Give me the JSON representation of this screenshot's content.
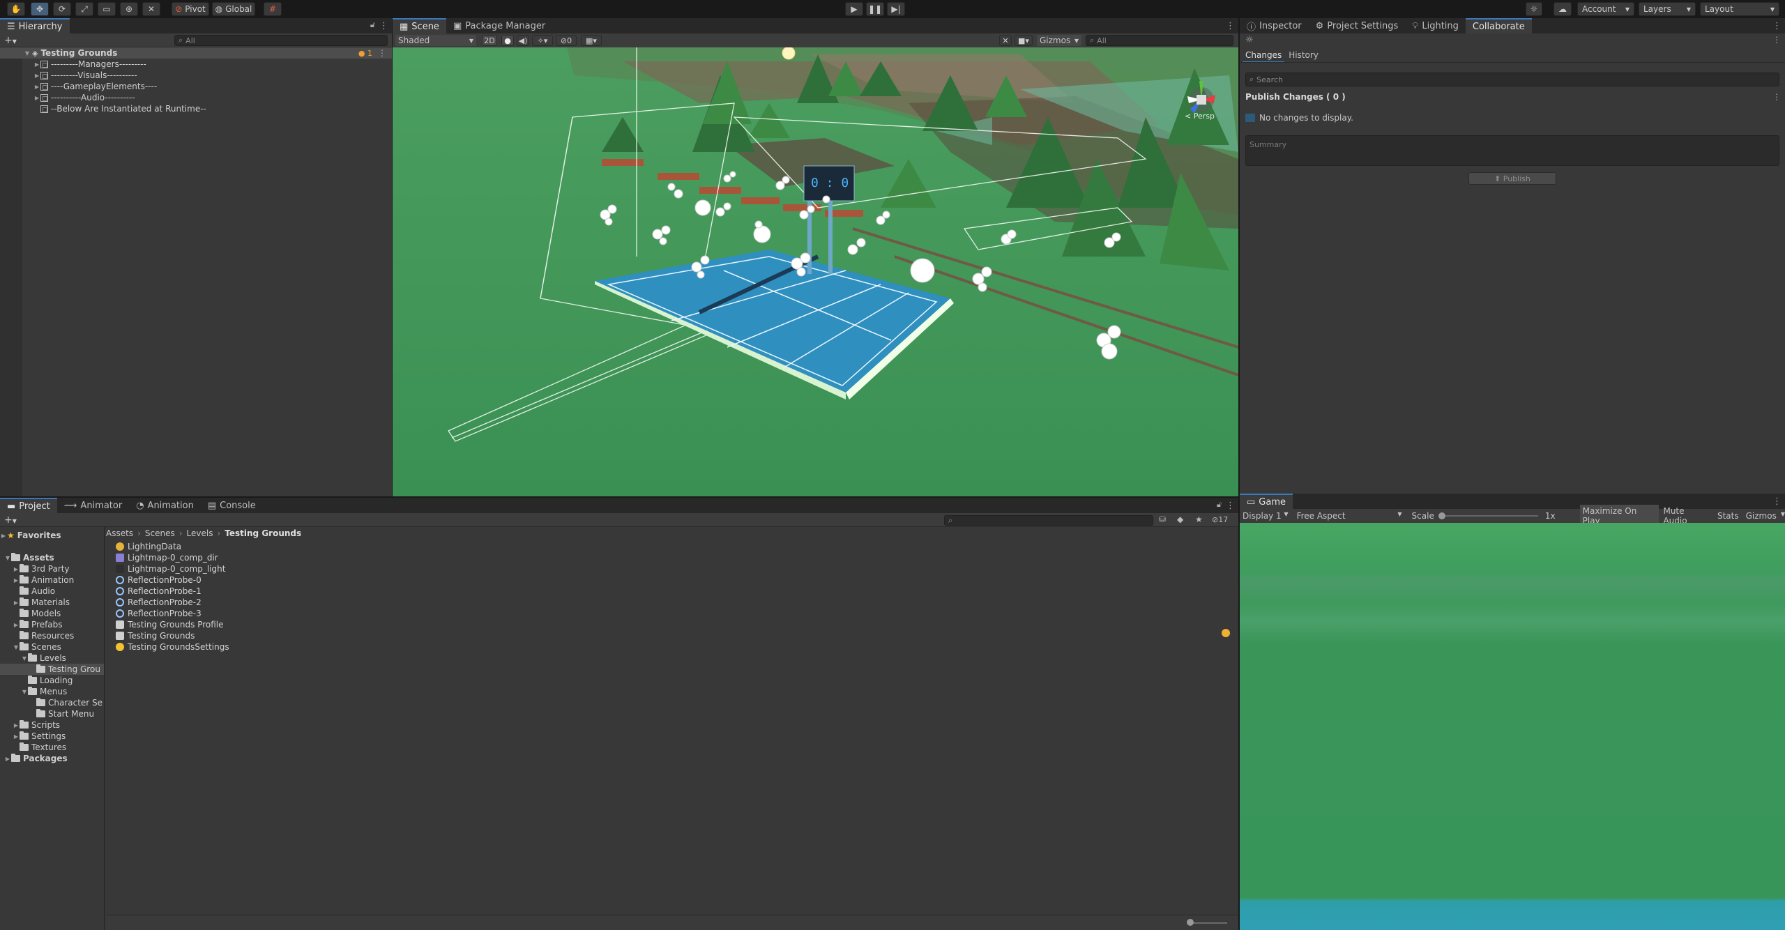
{
  "toolbar": {
    "tools": [
      "hand-tool",
      "move-tool",
      "rotate-tool",
      "scale-tool",
      "rect-tool",
      "transform-tool",
      "custom-tool"
    ],
    "pivot_label": "Pivot",
    "global_label": "Global",
    "account_label": "Account",
    "layers_label": "Layers",
    "layout_label": "Layout"
  },
  "hierarchy": {
    "tab_label": "Hierarchy",
    "search_placeholder": "All",
    "scene_name": "Testing Grounds",
    "badge_count": "1",
    "items": [
      "---------Managers---------",
      "---------Visuals----------",
      "----GameplayElements----",
      "----------Audio----------",
      "--Below Are Instantiated at Runtime--"
    ]
  },
  "scene_view": {
    "tabs": [
      "Scene",
      "Package Manager"
    ],
    "shading_mode": "Shaded",
    "mode_2d": "2D",
    "hidden_count": "0",
    "gizmos_label": "Gizmos",
    "search_placeholder": "All",
    "persp_label": "< Persp",
    "axis_labels": {
      "x": "x",
      "y": "y",
      "z": "z"
    }
  },
  "inspector": {
    "tabs": [
      "Inspector",
      "Project Settings",
      "Lighting",
      "Collaborate"
    ],
    "sub_tabs": [
      "Changes",
      "History"
    ],
    "search_placeholder": "Search",
    "publish_changes_title": "Publish Changes ( 0 )",
    "no_changes_text": "No changes to display.",
    "summary_placeholder": "Summary",
    "publish_button": "Publish"
  },
  "project": {
    "tabs": [
      "Project",
      "Animator",
      "Animation",
      "Console"
    ],
    "hidden_count": "17",
    "favorites_label": "Favorites",
    "folder_tree": [
      {
        "label": "Assets",
        "depth": 0,
        "open": true,
        "bold": true
      },
      {
        "label": "3rd Party",
        "depth": 1,
        "open": false
      },
      {
        "label": "Animation",
        "depth": 1,
        "open": false
      },
      {
        "label": "Audio",
        "depth": 1,
        "open": null
      },
      {
        "label": "Materials",
        "depth": 1,
        "open": false
      },
      {
        "label": "Models",
        "depth": 1,
        "open": null
      },
      {
        "label": "Prefabs",
        "depth": 1,
        "open": false
      },
      {
        "label": "Resources",
        "depth": 1,
        "open": null
      },
      {
        "label": "Scenes",
        "depth": 1,
        "open": true
      },
      {
        "label": "Levels",
        "depth": 2,
        "open": true
      },
      {
        "label": "Testing Grou",
        "depth": 3,
        "open": null,
        "selected": true
      },
      {
        "label": "Loading",
        "depth": 2,
        "open": null
      },
      {
        "label": "Menus",
        "depth": 2,
        "open": true
      },
      {
        "label": "Character Se",
        "depth": 3,
        "open": null
      },
      {
        "label": "Start Menu",
        "depth": 3,
        "open": null
      },
      {
        "label": "Scripts",
        "depth": 1,
        "open": false
      },
      {
        "label": "Settings",
        "depth": 1,
        "open": false
      },
      {
        "label": "Textures",
        "depth": 1,
        "open": null
      },
      {
        "label": "Packages",
        "depth": 0,
        "open": false,
        "bold": true
      }
    ],
    "breadcrumb": [
      "Assets",
      "Scenes",
      "Levels",
      "Testing Grounds"
    ],
    "assets": [
      {
        "label": "LightingData",
        "icon": "lighting-data-icon",
        "color": "#e8b23a"
      },
      {
        "label": "Lightmap-0_comp_dir",
        "icon": "texture-icon",
        "color": "#8a7fd6"
      },
      {
        "label": "Lightmap-0_comp_light",
        "icon": "texture-icon",
        "color": "#2f2f2f"
      },
      {
        "label": "ReflectionProbe-0",
        "icon": "reflection-probe-icon",
        "color": "#9ac6ff"
      },
      {
        "label": "ReflectionProbe-1",
        "icon": "reflection-probe-icon",
        "color": "#9ac6ff"
      },
      {
        "label": "ReflectionProbe-2",
        "icon": "reflection-probe-icon",
        "color": "#9ac6ff"
      },
      {
        "label": "ReflectionProbe-3",
        "icon": "reflection-probe-icon",
        "color": "#9ac6ff"
      },
      {
        "label": "Testing Grounds Profile",
        "icon": "volume-profile-icon",
        "color": "#d0d0d0"
      },
      {
        "label": "Testing Grounds",
        "icon": "scene-icon",
        "color": "#d0d0d0"
      },
      {
        "label": "Testing GroundsSettings",
        "icon": "lighting-settings-icon",
        "color": "#f2c230"
      }
    ]
  },
  "game_view": {
    "tab_label": "Game",
    "display": "Display 1",
    "aspect": "Free Aspect",
    "scale_label": "Scale",
    "scale_value": "1x",
    "maximize_label": "Maximize On Play",
    "mute_label": "Mute Audio",
    "stats_label": "Stats",
    "gizmos_label": "Gizmos"
  },
  "colors": {
    "accent": "#3a79bb",
    "editor_bg": "#383838",
    "grass": "#3f9657",
    "court": "#2f8fbf"
  }
}
